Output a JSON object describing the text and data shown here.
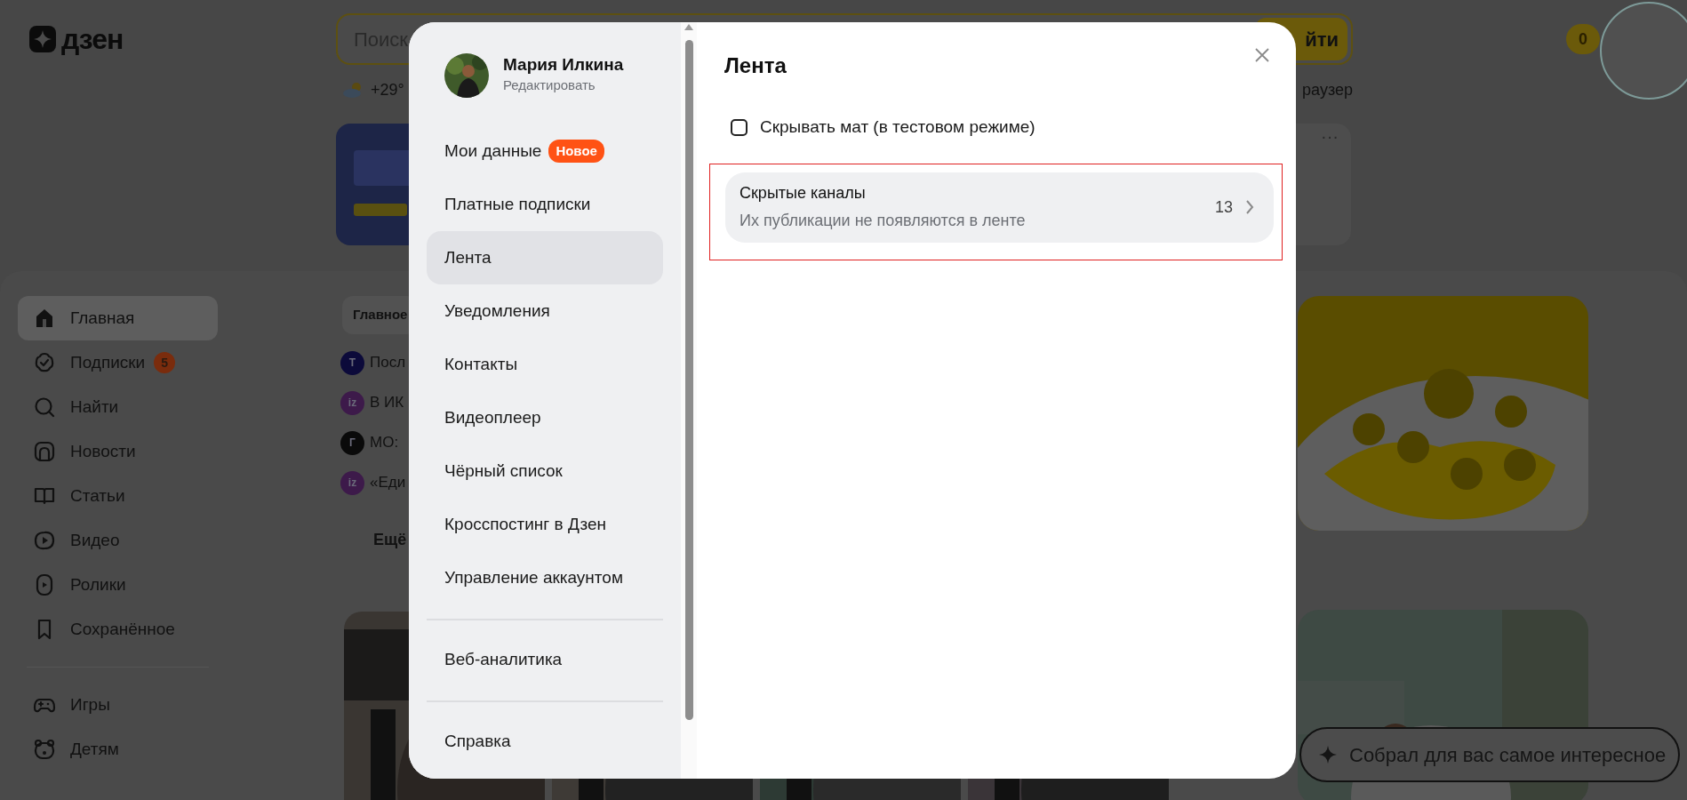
{
  "header": {
    "logo": "дзен",
    "search": {
      "placeholder": "Поиск",
      "button": "йти"
    },
    "weather": "+29°",
    "browser_link": "раузер",
    "coins": "0",
    "card_menu": "···"
  },
  "sidebar": {
    "sections": [
      [
        {
          "label": "Главная",
          "selected": true
        },
        {
          "label": "Подписки",
          "selected": false,
          "badge": "5"
        },
        {
          "label": "Найти",
          "selected": false
        },
        {
          "label": "Новости",
          "selected": false
        },
        {
          "label": "Статьи",
          "selected": false
        },
        {
          "label": "Видео",
          "selected": false
        },
        {
          "label": "Ролики",
          "selected": false
        },
        {
          "label": "Сохранённое",
          "selected": false
        }
      ],
      [
        {
          "label": "Игры",
          "selected": false
        },
        {
          "label": "Детям",
          "selected": false
        }
      ]
    ]
  },
  "feed": {
    "chip": "Главное",
    "news": [
      {
        "logo": "T",
        "color": "#0c0a3a",
        "text": "Посл"
      },
      {
        "logo": "iz",
        "color": "#3d1a4a",
        "text": "В ИК"
      },
      {
        "logo": "Г",
        "color": "#0a0a0a",
        "text": "МО:"
      },
      {
        "logo": "iz",
        "color": "#3d1a4a",
        "text": "«Еди"
      }
    ],
    "more": "Ещё"
  },
  "bottom_pill": "Собрал для вас самое интересное",
  "modal": {
    "user": {
      "name": "Мария Илкина",
      "action": "Редактировать"
    },
    "menu": [
      [
        {
          "label": "Мои данные",
          "badge": "Новое",
          "selected": false
        },
        {
          "label": "Платные подписки",
          "selected": false
        },
        {
          "label": "Лента",
          "selected": true
        },
        {
          "label": "Уведомления",
          "selected": false
        },
        {
          "label": "Контакты",
          "selected": false
        },
        {
          "label": "Видеоплеер",
          "selected": false
        },
        {
          "label": "Чёрный список",
          "selected": false
        },
        {
          "label": "Кросспостинг в Дзен",
          "selected": false
        },
        {
          "label": "Управление аккаунтом",
          "selected": false
        }
      ],
      [
        {
          "label": "Веб-аналитика",
          "selected": false
        }
      ],
      [
        {
          "label": "Справка",
          "selected": false
        }
      ]
    ],
    "title": "Лента",
    "options": [
      {
        "kind": "checkbox",
        "label": "Скрывать мат (в тестовом режиме)",
        "checked": false
      },
      {
        "kind": "link",
        "title": "Скрытые каналы",
        "subtitle": "Их публикации не появляются в ленте",
        "count": "13",
        "annotated": true
      }
    ]
  }
}
